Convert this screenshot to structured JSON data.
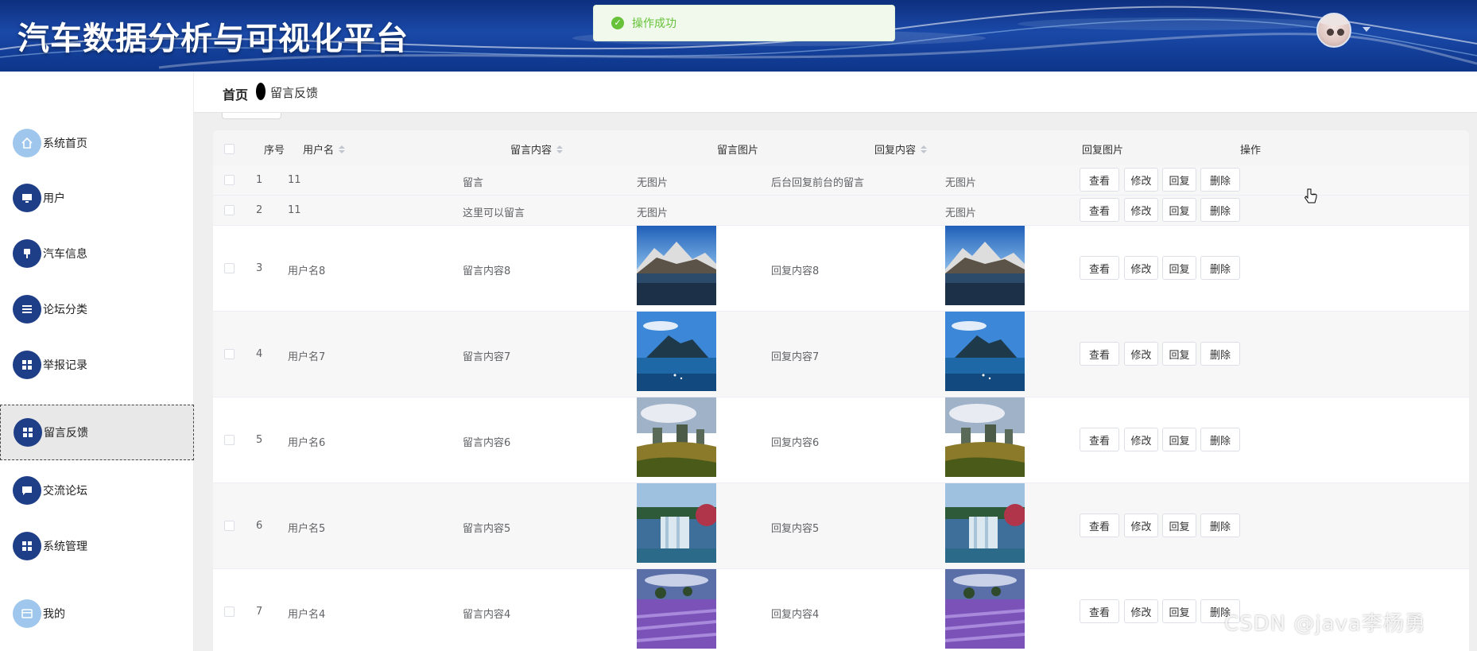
{
  "header": {
    "app_title": "汽车数据分析与可视化平台",
    "toast_text": "操作成功",
    "toast_color": "#67c23a",
    "brand_color": "#1a49a8"
  },
  "sidebar": {
    "items": [
      {
        "label": "系统首页",
        "icon": "home-icon"
      },
      {
        "label": "用户",
        "icon": "monitor-icon"
      },
      {
        "label": "汽车信息",
        "icon": "pin-icon"
      },
      {
        "label": "论坛分类",
        "icon": "list-icon"
      },
      {
        "label": "举报记录",
        "icon": "grid-icon"
      },
      {
        "label": "留言反馈",
        "icon": "grid-icon",
        "active": true
      },
      {
        "label": "交流论坛",
        "icon": "chat-icon"
      },
      {
        "label": "系统管理",
        "icon": "grid-icon"
      },
      {
        "label": "我的",
        "icon": "card-icon"
      }
    ]
  },
  "breadcrumb": {
    "home": "首页",
    "current": "留言反馈"
  },
  "table": {
    "columns": {
      "index": "序号",
      "username": "用户名",
      "content": "留言内容",
      "image": "留言图片",
      "reply": "回复内容",
      "reply_image": "回复图片",
      "actions": "操作"
    },
    "buttons": {
      "view": "查看",
      "edit": "修改",
      "reply": "回复",
      "delete": "删除"
    },
    "rows": [
      {
        "index": "1",
        "username": "11",
        "content": "留言",
        "image": "无图片",
        "reply": "后台回复前台的留言",
        "reply_image": "无图片"
      },
      {
        "index": "2",
        "username": "11",
        "content": "这里可以留言",
        "image": "无图片",
        "reply": "",
        "reply_image": "无图片"
      },
      {
        "index": "3",
        "username": "用户名8",
        "content": "留言内容8",
        "image": "mountain-lake-photo",
        "reply": "回复内容8",
        "reply_image": "mountain-lake-photo"
      },
      {
        "index": "4",
        "username": "用户名7",
        "content": "留言内容7",
        "image": "island-lake-photo",
        "reply": "回复内容7",
        "reply_image": "island-lake-photo"
      },
      {
        "index": "5",
        "username": "用户名6",
        "content": "留言内容6",
        "image": "canyon-cliffs-photo",
        "reply": "回复内容6",
        "reply_image": "canyon-cliffs-photo"
      },
      {
        "index": "6",
        "username": "用户名5",
        "content": "留言内容5",
        "image": "waterfall-photo",
        "reply": "回复内容5",
        "reply_image": "waterfall-photo"
      },
      {
        "index": "7",
        "username": "用户名4",
        "content": "留言内容4",
        "image": "lavender-field-photo",
        "reply": "回复内容4",
        "reply_image": "lavender-field-photo"
      }
    ]
  },
  "watermark": "CSDN @java李杨勇"
}
